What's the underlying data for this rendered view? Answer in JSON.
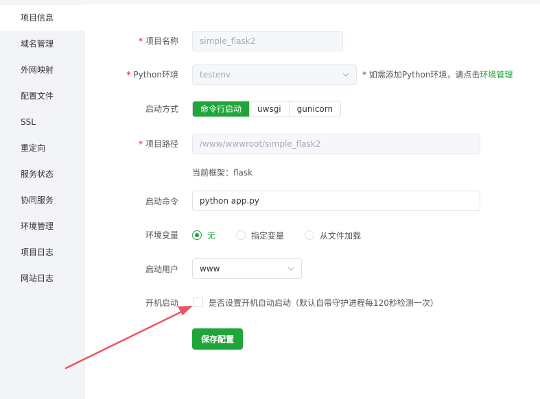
{
  "sidebar": {
    "items": [
      {
        "label": "项目信息"
      },
      {
        "label": "域名管理"
      },
      {
        "label": "外网映射"
      },
      {
        "label": "配置文件"
      },
      {
        "label": "SSL"
      },
      {
        "label": "重定向"
      },
      {
        "label": "服务状态"
      },
      {
        "label": "协同服务"
      },
      {
        "label": "环境管理"
      },
      {
        "label": "项目日志"
      },
      {
        "label": "网站日志"
      }
    ],
    "active_index": 0
  },
  "form": {
    "required_mark": "*",
    "project_name": {
      "label": "项目名称",
      "value": "simple_flask2"
    },
    "python_env": {
      "label": "Python环境",
      "value": "testenv",
      "hint_prefix": "* 如需添加Python环境，请点击",
      "hint_link": "环境管理"
    },
    "start_mode": {
      "label": "启动方式",
      "options": [
        "命令行启动",
        "uwsgi",
        "gunicorn"
      ],
      "selected_index": 0
    },
    "project_path": {
      "label": "项目路径",
      "value": "/www/wwwroot/simple_flask2",
      "framework_note": "当前框架：flask"
    },
    "start_command": {
      "label": "启动命令",
      "value": "python app.py"
    },
    "env_vars": {
      "label": "环境变量",
      "options": [
        "无",
        "指定变量",
        "从文件加载"
      ],
      "selected_index": 0
    },
    "start_user": {
      "label": "启动用户",
      "value": "www"
    },
    "boot_start": {
      "label": "开机启动",
      "checkbox_text": "是否设置开机自动启动（默认自带守护进程每120秒检测一次）",
      "checked": false
    },
    "save_label": "保存配置"
  },
  "colors": {
    "accent": "#20a53a",
    "required": "#ef0808",
    "annotation_arrow": "#f0525e"
  }
}
